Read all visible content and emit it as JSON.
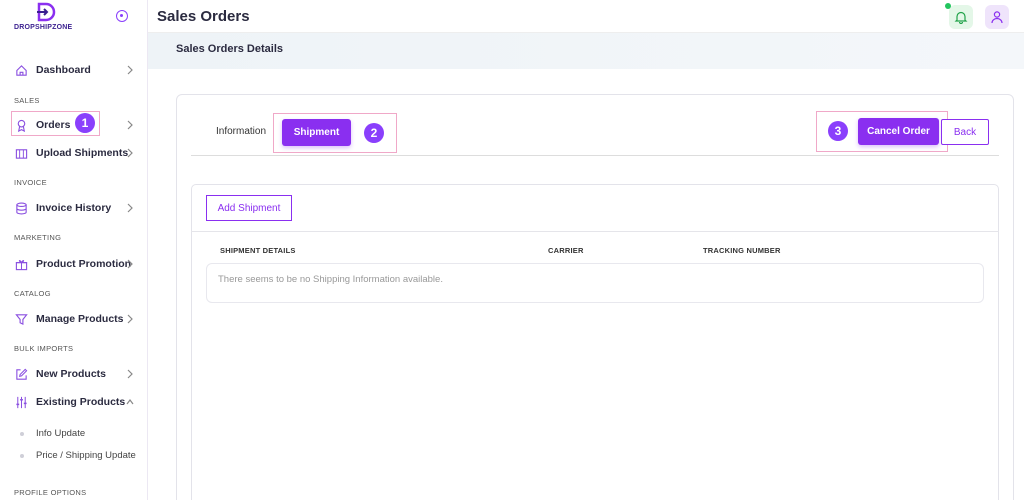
{
  "brand": {
    "name": "DROPSHIPZONE"
  },
  "header": {
    "title": "Sales Orders",
    "subtitle": "Sales Orders Details"
  },
  "sidebar": {
    "dashboard": "Dashboard",
    "sections": {
      "sales": "SALES",
      "invoice": "INVOICE",
      "marketing": "MARKETING",
      "catalog": "CATALOG",
      "bulk_imports": "BULK IMPORTS",
      "profile_options": "PROFILE OPTIONS"
    },
    "items": {
      "orders": "Orders",
      "upload_shipments": "Upload Shipments",
      "invoice_history": "Invoice History",
      "product_promotion": "Product Promotion",
      "manage_products": "Manage Products",
      "new_products": "New Products",
      "existing_products": "Existing Products"
    },
    "sub_items": {
      "info_update": "Info Update",
      "price_shipping_update": "Price / Shipping Update"
    }
  },
  "tabs": {
    "information": "Information",
    "shipment": "Shipment"
  },
  "actions": {
    "cancel_order": "Cancel Order",
    "back": "Back",
    "add_shipment": "Add Shipment"
  },
  "table": {
    "columns": [
      "SHIPMENT DETAILS",
      "CARRIER",
      "TRACKING NUMBER"
    ],
    "empty_message": "There seems to be no Shipping Information available."
  },
  "steps": [
    "1",
    "2",
    "3"
  ],
  "colors": {
    "accent": "#8a2ff0",
    "highlight": "#f0a8c8"
  }
}
